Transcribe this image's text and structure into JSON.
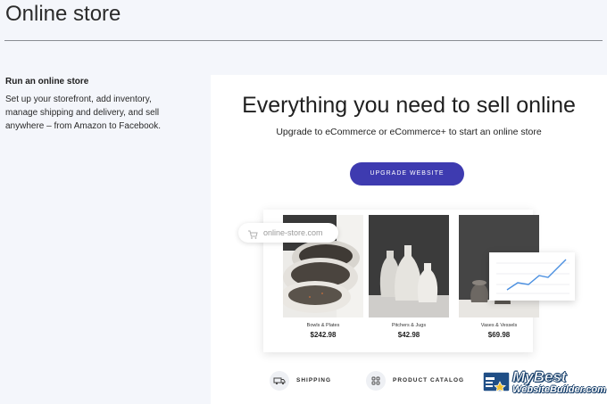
{
  "page": {
    "title": "Online store"
  },
  "sidebar": {
    "heading": "Run an online store",
    "description": "Set up your storefront, add inventory, manage shipping and delivery, and sell anywhere – from Amazon to Facebook."
  },
  "hero": {
    "title": "Everything you need to sell online",
    "subtitle": "Upgrade to eCommerce or eCommerce+ to start an online store",
    "button_label": "UPGRADE WEBSITE"
  },
  "store_preview": {
    "url": "online-store.com",
    "products": [
      {
        "name": "Bowls & Plates",
        "price": "$242.98"
      },
      {
        "name": "Pitchers & Jugs",
        "price": "$42.98"
      },
      {
        "name": "Vases & Vessels",
        "price": "$69.98"
      }
    ]
  },
  "features": [
    {
      "label": "SHIPPING",
      "icon": "truck-icon"
    },
    {
      "label": "PRODUCT CATALOG",
      "icon": "grid-icon"
    }
  ],
  "watermark": {
    "line1": "MyBest",
    "line2": "WebsiteBuilder.com"
  },
  "colors": {
    "accent": "#3e3bb0",
    "background": "#f4f6fb",
    "chart_line": "#4a8fe0"
  }
}
